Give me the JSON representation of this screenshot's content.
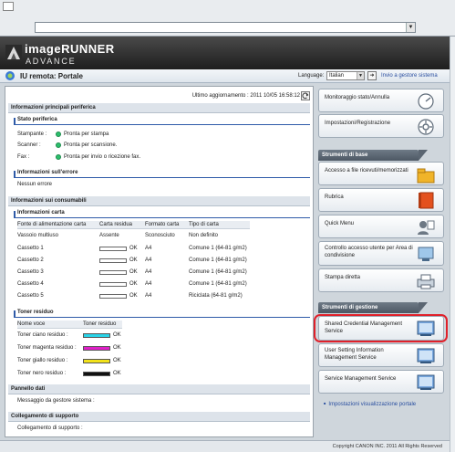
{
  "browser": {
    "url": ""
  },
  "brand": {
    "line1": "imageRUNNER",
    "line2": "ADVANCE"
  },
  "header": {
    "title": "IU remota: Portale",
    "language_label": "Language:",
    "language_value": "Italian",
    "manager_link": "Invio a gestore sistema"
  },
  "main": {
    "last_update": "Ultimo aggiornamento : 2011 10/05 16:58:12",
    "device_info": {
      "title": "Informazioni principali periferica",
      "status_title": "Stato periferica",
      "rows": [
        {
          "label": "Stampante :",
          "value": "Pronta per stampa"
        },
        {
          "label": "Scanner :",
          "value": "Pronta per scansione."
        },
        {
          "label": "Fax :",
          "value": "Pronta per invio o ricezione fax."
        }
      ],
      "error_title": "Informazioni sull'errore",
      "error_value": "Nessun errore"
    },
    "consumables": {
      "title": "Informazioni sui consumabili",
      "paper_title": "Informazioni carta",
      "paper_headers": [
        "Fonte di alimentazione carta",
        "Carta residua",
        "Formato carta",
        "Tipo di carta"
      ],
      "paper_rows": [
        {
          "source": "Vassoio multiuso",
          "remaining": "Assente",
          "size": "Sconosciuto",
          "type": "Non definito",
          "bar": false
        },
        {
          "source": "Cassetto 1",
          "remaining": "OK",
          "size": "A4",
          "type": "Comune 1 (64-81 g/m2)",
          "bar": true
        },
        {
          "source": "Cassetto 2",
          "remaining": "OK",
          "size": "A4",
          "type": "Comune 1 (64-81 g/m2)",
          "bar": true
        },
        {
          "source": "Cassetto 3",
          "remaining": "OK",
          "size": "A4",
          "type": "Comune 1 (64-81 g/m2)",
          "bar": true
        },
        {
          "source": "Cassetto 4",
          "remaining": "OK",
          "size": "A4",
          "type": "Comune 1 (64-81 g/m2)",
          "bar": true
        },
        {
          "source": "Cassetto 5",
          "remaining": "OK",
          "size": "A4",
          "type": "Riciclata (64-81 g/m2)",
          "bar": true
        }
      ],
      "toner_title": "Toner residuo",
      "toner_headers": [
        "Nome voce",
        "Toner residuo"
      ],
      "toner_rows": [
        {
          "name": "Toner ciano residuo :",
          "value": "OK",
          "color": "#29d4e8"
        },
        {
          "name": "Toner magenta residuo :",
          "value": "OK",
          "color": "#e020c8"
        },
        {
          "name": "Toner giallo residuo :",
          "value": "OK",
          "color": "#f2e21a"
        },
        {
          "name": "Toner nero residuo :",
          "value": "OK",
          "color": "#111111"
        }
      ]
    },
    "data_panel": {
      "title": "Pannello dati",
      "label": "Messaggio da gestore sistema :"
    },
    "support": {
      "title": "Collegamento di supporto",
      "label": "Collegamento di supporto :"
    }
  },
  "right": {
    "top_buttons": [
      {
        "label": "Monitoraggio stato/Annulla",
        "icon": "monitor-dial-icon"
      },
      {
        "label": "Impostazioni/Registrazione",
        "icon": "settings-icon"
      }
    ],
    "basic_tools_title": "Strumenti di base",
    "basic_tools": [
      {
        "label": "Accesso a file ricevuti/memorizzati",
        "icon": "folder-icon"
      },
      {
        "label": "Rubrica",
        "icon": "address-book-icon"
      },
      {
        "label": "Quick Menu",
        "icon": "quick-menu-icon"
      },
      {
        "label": "Controllo accesso utente per Area di condivisione",
        "icon": "user-access-icon"
      },
      {
        "label": "Stampa diretta",
        "icon": "printer-icon"
      }
    ],
    "mgmt_tools_title": "Strumenti di gestione",
    "mgmt_tools": [
      {
        "label": "Shared Credential Management Service",
        "icon": "monitor-icon"
      },
      {
        "label": "User Setting Information Management Service",
        "icon": "monitor-icon"
      },
      {
        "label": "Service Management Service",
        "icon": "monitor-icon"
      }
    ],
    "display_link": "Impostazioni visualizzazione portale"
  },
  "footer": {
    "copyright": "Copyright CANON INC. 2011 All Rights Reserved"
  }
}
